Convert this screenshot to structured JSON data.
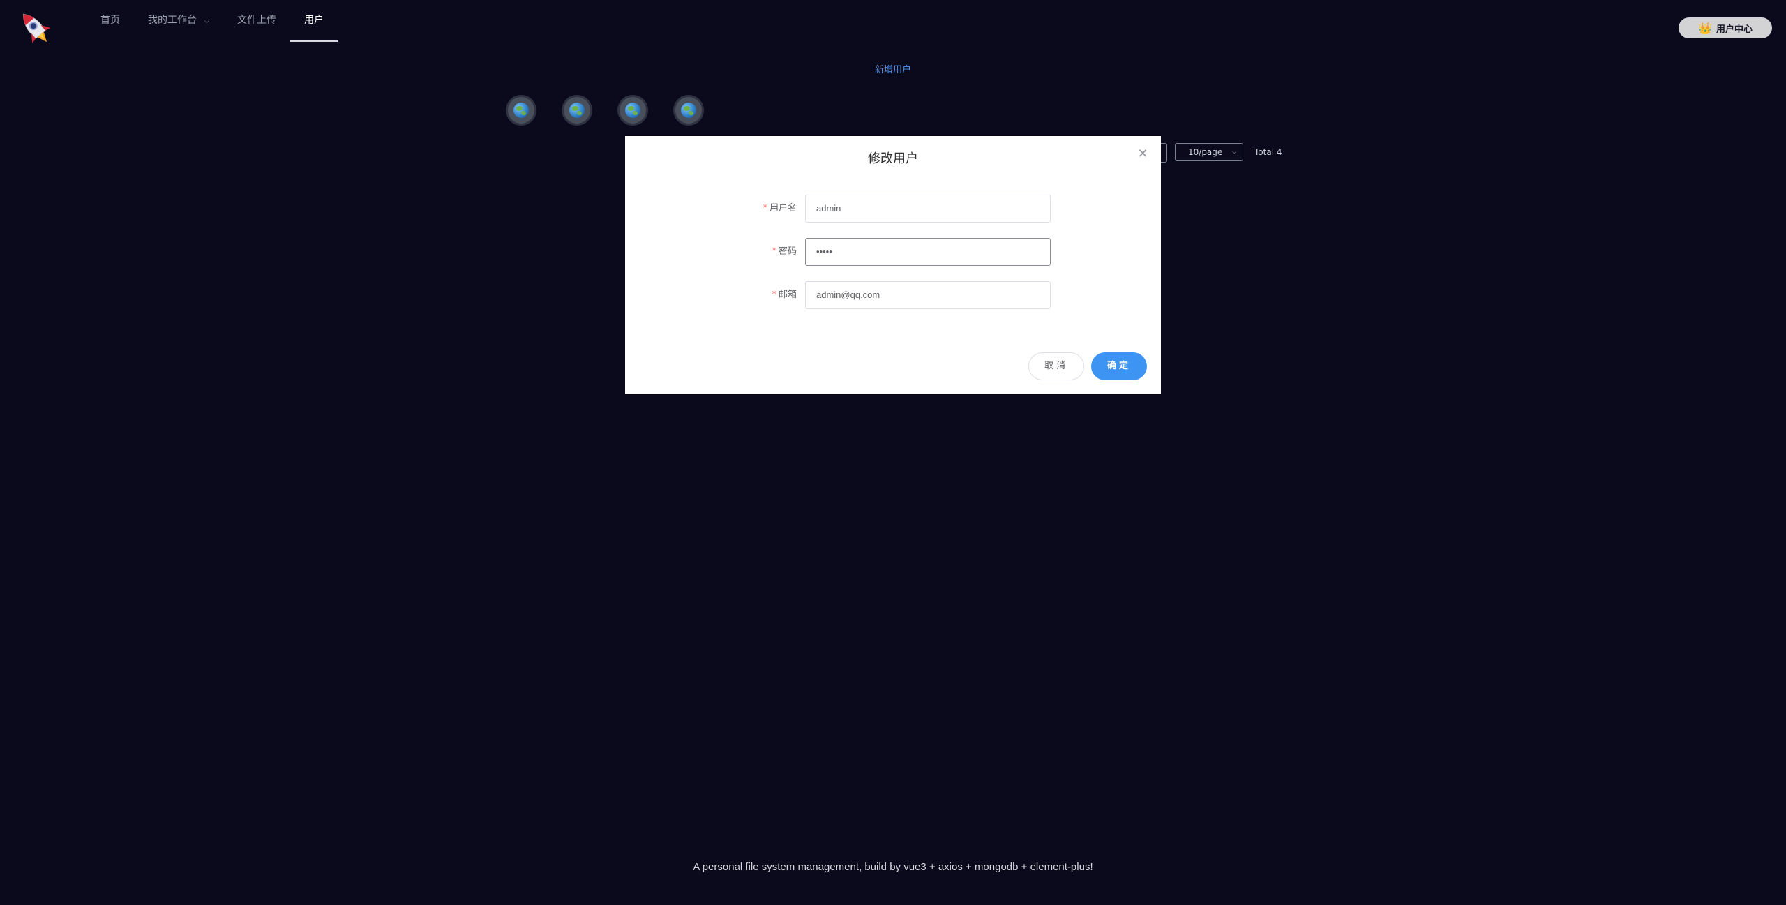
{
  "header": {
    "logo_icon": "rocket-icon",
    "nav": [
      {
        "label": "首页",
        "active": false
      },
      {
        "label": "我的工作台",
        "active": false,
        "has_dropdown": true
      },
      {
        "label": "文件上传",
        "active": false
      },
      {
        "label": "用户",
        "active": true
      }
    ],
    "user_center_label": "用户中心",
    "user_center_icon": "crown-icon"
  },
  "main": {
    "add_user_label": "新增用户",
    "avatars": [
      {
        "icon": "earth-icon"
      },
      {
        "icon": "earth-icon"
      },
      {
        "icon": "earth-icon"
      },
      {
        "icon": "earth-icon"
      }
    ],
    "pagination": {
      "page_size": "10/page",
      "total": "Total 4"
    }
  },
  "dialog": {
    "title": "修改用户",
    "fields": [
      {
        "label": "用户名",
        "value": "admin",
        "required": true
      },
      {
        "label": "密码",
        "value": "•••••",
        "required": true
      },
      {
        "label": "邮箱",
        "value": "admin@qq.com",
        "required": true
      }
    ],
    "cancel_label": "取消",
    "confirm_label": "确定"
  },
  "footer": {
    "text": "A personal file system management, build by vue3 + axios + mongodb + element-plus!"
  },
  "colors": {
    "background": "#0b0a1c",
    "primary": "#3d94f2",
    "link": "#4f8fe6",
    "required": "#f56c6c"
  }
}
